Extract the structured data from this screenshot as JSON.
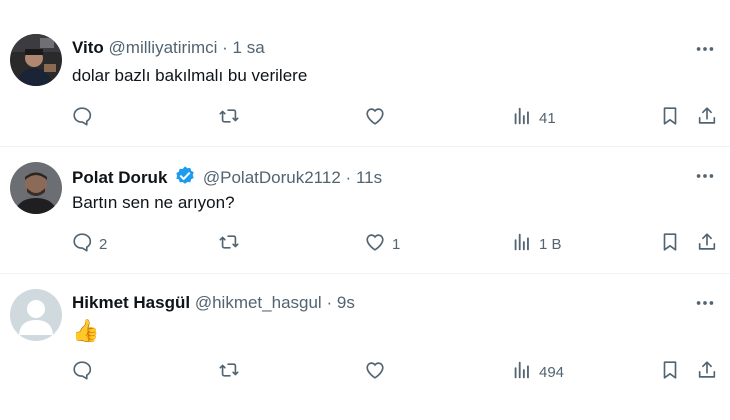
{
  "tweets": [
    {
      "name": "Vito",
      "handle": "@milliyatirimci",
      "sep": "·",
      "time": "1 sa",
      "text": "dolar bazlı bakılmalı bu verilere",
      "verified": false,
      "replies": "",
      "retweets": "",
      "likes": "",
      "views": "41"
    },
    {
      "name": "Polat Doruk",
      "handle": "@PolatDoruk2112",
      "sep": "·",
      "time": "11s",
      "text": "Bartın sen ne arıyon?",
      "verified": true,
      "replies": "2",
      "retweets": "",
      "likes": "1",
      "views": "1 B"
    },
    {
      "name": "Hikmet Hasgül",
      "handle": "@hikmet_hasgul",
      "sep": "·",
      "time": "9s",
      "text": "👍",
      "verified": false,
      "replies": "",
      "retweets": "",
      "likes": "",
      "views": "494"
    }
  ],
  "colors": {
    "text": "#0f1419",
    "muted": "#536471",
    "verified_blue": "#1d9bf0",
    "divider": "#eff3f4",
    "default_avatar_bg": "#cfd9de"
  },
  "icons": [
    "reply-icon",
    "retweet-icon",
    "like-icon",
    "views-icon",
    "bookmark-icon",
    "share-icon",
    "more-icon",
    "verified-badge-icon"
  ]
}
